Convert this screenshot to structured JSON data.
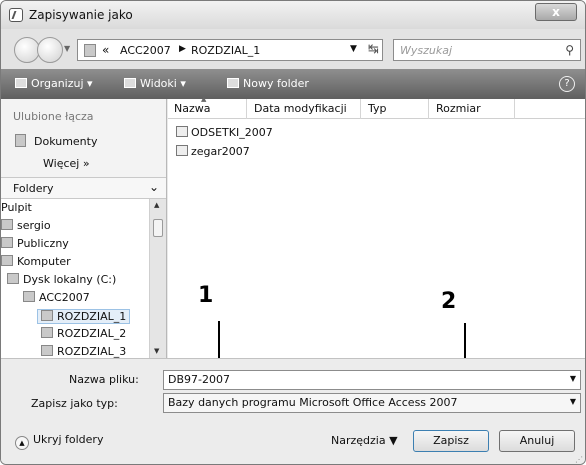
{
  "window": {
    "title": "Zapisywanie jako",
    "close_label": "x"
  },
  "address": {
    "chevron": "«",
    "segments": [
      "ACC2007",
      "ROZDZIAL_1"
    ],
    "search_placeholder": "Wyszukaj"
  },
  "toolbar": {
    "organize": "Organizuj",
    "views": "Widoki",
    "new_folder": "Nowy folder",
    "help": "?"
  },
  "favorites": {
    "header": "Ulubione łącza",
    "items": [
      "Dokumenty"
    ],
    "more": "Więcej  »"
  },
  "folders": {
    "header": "Foldery",
    "tree": [
      "Pulpit",
      "sergio",
      "Publiczny",
      "Komputer",
      "Dysk lokalny (C:)",
      "ACC2007",
      "ROZDZIAL_1",
      "ROZDZIAL_2",
      "ROZDZIAL_3"
    ]
  },
  "filelist": {
    "columns": [
      "Nazwa",
      "Data modyfikacji",
      "Typ",
      "Rozmiar"
    ],
    "files": [
      "ODSETKI_2007",
      "zegar2007"
    ]
  },
  "callouts": [
    "1",
    "2"
  ],
  "form": {
    "filename_label": "Nazwa pliku:",
    "filename_value": "DB97-2007",
    "filetype_label": "Zapisz jako typ:",
    "filetype_value": "Bazy danych programu Microsoft Office Access 2007"
  },
  "footer": {
    "hide_folders": "Ukryj foldery",
    "tools": "Narzędzia",
    "save": "Zapisz",
    "cancel": "Anuluj"
  }
}
